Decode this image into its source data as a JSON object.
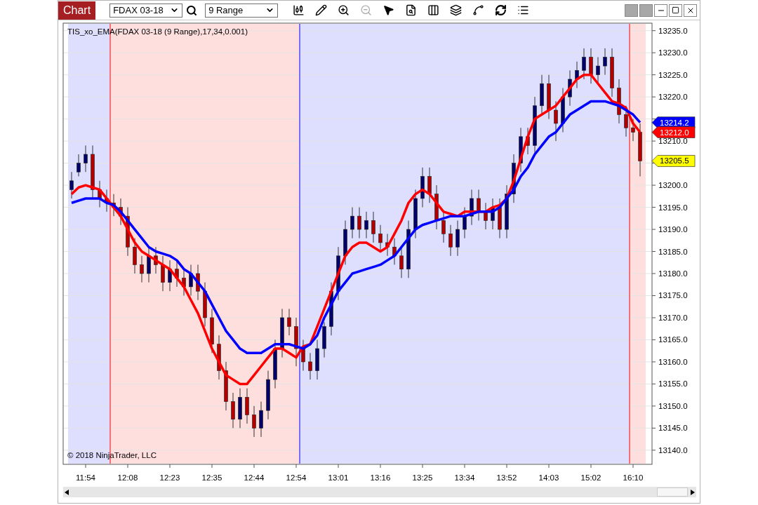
{
  "window": {
    "title": "Chart"
  },
  "toolbar": {
    "instrument": "FDAX 03-18",
    "interval": "9 Range"
  },
  "chart": {
    "indicator_label": "TIS_xo_EMA(FDAX 03-18 (9 Range),17,34,0.001)",
    "copyright": "© 2018 NinjaTrader, LLC",
    "price_markers": [
      {
        "kind": "slow",
        "text": "13214.2",
        "color": "#0000ff"
      },
      {
        "kind": "fast",
        "text": "13212.0",
        "color": "#ff0000"
      },
      {
        "kind": "close",
        "text": "13205.5",
        "color": "#ffff00"
      }
    ],
    "chart_data": {
      "type": "candlestick",
      "categories": [
        null,
        null,
        "11:54",
        null,
        null,
        null,
        null,
        null,
        "12:08",
        null,
        null,
        null,
        null,
        null,
        "12:23",
        null,
        null,
        null,
        null,
        null,
        "12:35",
        null,
        null,
        null,
        null,
        null,
        "12:44",
        null,
        null,
        null,
        null,
        null,
        "12:54",
        null,
        null,
        null,
        null,
        null,
        "13:01",
        null,
        null,
        null,
        null,
        null,
        "13:16",
        null,
        null,
        null,
        null,
        null,
        "13:25",
        null,
        null,
        null,
        null,
        null,
        "13:34",
        null,
        null,
        null,
        null,
        null,
        "13:52",
        null,
        null,
        null,
        null,
        null,
        "14:03",
        null,
        null,
        null,
        null,
        null,
        "15:02",
        null,
        null,
        null,
        null,
        null,
        "16:10",
        null
      ],
      "ohlc": [
        [
          13199,
          13203,
          13197,
          13201
        ],
        [
          13203,
          13207,
          13202,
          13205
        ],
        [
          13205,
          13209,
          13203,
          13207
        ],
        [
          13207,
          13209,
          13197,
          13199
        ],
        [
          13199,
          13201,
          13195,
          13197
        ],
        [
          13197,
          13199,
          13194,
          13196
        ],
        [
          13196,
          13198,
          13193,
          13195
        ],
        [
          13195,
          13197,
          13191,
          13193
        ],
        [
          13193,
          13195,
          13184,
          13186
        ],
        [
          13186,
          13188,
          13180,
          13182
        ],
        [
          13182,
          13184,
          13178,
          13180
        ],
        [
          13180,
          13186,
          13178,
          13184
        ],
        [
          13184,
          13186,
          13180,
          13182
        ],
        [
          13182,
          13184,
          13176,
          13178
        ],
        [
          13178,
          13183,
          13176,
          13181
        ],
        [
          13181,
          13183,
          13177,
          13179
        ],
        [
          13179,
          13181,
          13175,
          13177
        ],
        [
          13177,
          13182,
          13175,
          13180
        ],
        [
          13180,
          13182,
          13174,
          13176
        ],
        [
          13176,
          13178,
          13168,
          13170
        ],
        [
          13170,
          13172,
          13162,
          13164
        ],
        [
          13164,
          13166,
          13156,
          13158
        ],
        [
          13158,
          13160,
          13149,
          13151
        ],
        [
          13151,
          13153,
          13145,
          13147
        ],
        [
          13147,
          13154,
          13145,
          13152
        ],
        [
          13152,
          13154,
          13146,
          13148
        ],
        [
          13148,
          13150,
          13143,
          13145
        ],
        [
          13145,
          13151,
          13143,
          13149
        ],
        [
          13149,
          13158,
          13147,
          13156
        ],
        [
          13156,
          13165,
          13154,
          13163
        ],
        [
          13163,
          13172,
          13161,
          13170
        ],
        [
          13170,
          13172,
          13166,
          13168
        ],
        [
          13168,
          13170,
          13159,
          13163
        ],
        [
          13163,
          13165,
          13158,
          13160
        ],
        [
          13160,
          13162,
          13156,
          13158
        ],
        [
          13158,
          13165,
          13156,
          13163
        ],
        [
          13163,
          13169,
          13161,
          13168
        ],
        [
          13168,
          13178,
          13166,
          13176
        ],
        [
          13176,
          13186,
          13174,
          13184
        ],
        [
          13184,
          13192,
          13182,
          13190
        ],
        [
          13190,
          13195,
          13188,
          13193
        ],
        [
          13193,
          13195,
          13188,
          13190
        ],
        [
          13190,
          13194,
          13188,
          13192
        ],
        [
          13192,
          13194,
          13187,
          13189
        ],
        [
          13189,
          13191,
          13185,
          13187
        ],
        [
          13187,
          13189,
          13184,
          13186
        ],
        [
          13186,
          13188,
          13182,
          13184
        ],
        [
          13184,
          13186,
          13179,
          13181
        ],
        [
          13181,
          13192,
          13179,
          13190
        ],
        [
          13190,
          13199,
          13188,
          13197
        ],
        [
          13197,
          13204,
          13195,
          13202
        ],
        [
          13202,
          13204,
          13196,
          13198
        ],
        [
          13198,
          13200,
          13190,
          13192
        ],
        [
          13192,
          13194,
          13187,
          13189
        ],
        [
          13189,
          13191,
          13184,
          13186
        ],
        [
          13186,
          13192,
          13184,
          13190
        ],
        [
          13190,
          13195,
          13188,
          13193
        ],
        [
          13193,
          13199,
          13191,
          13197
        ],
        [
          13197,
          13199,
          13192,
          13194
        ],
        [
          13194,
          13196,
          13190,
          13192
        ],
        [
          13192,
          13197,
          13190,
          13195
        ],
        [
          13195,
          13197,
          13188,
          13190
        ],
        [
          13190,
          13200,
          13188,
          13198
        ],
        [
          13198,
          13207,
          13196,
          13205
        ],
        [
          13205,
          13213,
          13203,
          13211
        ],
        [
          13211,
          13213,
          13207,
          13209
        ],
        [
          13209,
          13220,
          13207,
          13218
        ],
        [
          13218,
          13225,
          13216,
          13223
        ],
        [
          13223,
          13225,
          13215,
          13217
        ],
        [
          13217,
          13219,
          13210,
          13214
        ],
        [
          13214,
          13222,
          13212,
          13220
        ],
        [
          13220,
          13226,
          13218,
          13224
        ],
        [
          13224,
          13228,
          13222,
          13226
        ],
        [
          13226,
          13231,
          13224,
          13229
        ],
        [
          13229,
          13231,
          13223,
          13225
        ],
        [
          13225,
          13229,
          13223,
          13227
        ],
        [
          13227,
          13231,
          13225,
          13229
        ],
        [
          13229,
          13231,
          13220,
          13222
        ],
        [
          13222,
          13224,
          13214,
          13216
        ],
        [
          13216,
          13218,
          13211,
          13213
        ],
        [
          13213,
          13215,
          13210,
          13212
        ],
        [
          13212,
          13214,
          13202,
          13205.5
        ]
      ],
      "series": [
        {
          "type": "line",
          "color": "#ff0000",
          "values": [
            13198,
            13199.5,
            13200,
            13199.5,
            13199,
            13197,
            13195,
            13193,
            13190,
            13187,
            13185,
            13184,
            13183,
            13182,
            13181,
            13179,
            13177,
            13174,
            13171,
            13167,
            13163,
            13160,
            13157,
            13156,
            13155,
            13155,
            13157,
            13159,
            13161,
            13163,
            13163,
            13162,
            13161,
            13163.5,
            13164,
            13168,
            13172,
            13176,
            13180,
            13184,
            13186,
            13187,
            13187,
            13186,
            13185,
            13186,
            13189,
            13192,
            13196,
            13198,
            13199,
            13198,
            13196,
            13194,
            13193.5,
            13193,
            13194,
            13194,
            13194,
            13194,
            13195,
            13195.5,
            13197,
            13201,
            13206,
            13211,
            13215,
            13216,
            13217,
            13218,
            13220,
            13222,
            13224,
            13225,
            13225,
            13223,
            13221,
            13219,
            13218.5,
            13217.5,
            13214,
            13212.0
          ]
        },
        {
          "type": "line",
          "color": "#0000ff",
          "values": [
            13196,
            13196.5,
            13197,
            13197,
            13197,
            13196,
            13195.5,
            13194,
            13192,
            13190,
            13188,
            13186,
            13185,
            13184.5,
            13184,
            13183,
            13181,
            13180,
            13178,
            13176,
            13173,
            13170,
            13167,
            13165,
            13163,
            13162,
            13162,
            13162,
            13163,
            13164,
            13164,
            13164,
            13163.5,
            13163,
            13164,
            13166,
            13170,
            13173,
            13176,
            13178,
            13180,
            13180.5,
            13181,
            13181.5,
            13182,
            13183,
            13184,
            13186,
            13188,
            13190,
            13191,
            13191.5,
            13192,
            13192.5,
            13193,
            13193,
            13193,
            13193.5,
            13194,
            13194,
            13194,
            13195,
            13197,
            13199,
            13202,
            13204,
            13207,
            13209,
            13211,
            13212,
            13214,
            13216,
            13217,
            13218,
            13219,
            13219,
            13219,
            13218.5,
            13218,
            13217,
            13216,
            13214.2
          ]
        }
      ],
      "ylim": [
        13136.8,
        13236.7
      ],
      "yticks": [
        {
          "value": 13140,
          "label": "13140.0"
        },
        {
          "value": 13145,
          "label": "13145.0"
        },
        {
          "value": 13150,
          "label": "13150.0"
        },
        {
          "value": 13155,
          "label": "13155.0"
        },
        {
          "value": 13160,
          "label": "13160.0"
        },
        {
          "value": 13165,
          "label": "13165.0"
        },
        {
          "value": 13170,
          "label": "13170.0"
        },
        {
          "value": 13175,
          "label": "13175.0"
        },
        {
          "value": 13180,
          "label": "13180.0"
        },
        {
          "value": 13185,
          "label": "13185.0"
        },
        {
          "value": 13190,
          "label": "13190.0"
        },
        {
          "value": 13195,
          "label": "13195.0"
        },
        {
          "value": 13200,
          "label": "13200.0"
        },
        {
          "value": 13210,
          "label": "13210.0"
        },
        {
          "value": 13220,
          "label": "13220.0"
        },
        {
          "value": 13225,
          "label": "13225.0"
        },
        {
          "value": 13230,
          "label": "13230.0"
        },
        {
          "value": 13235,
          "label": "13235.0"
        }
      ],
      "grid": true
    }
  }
}
